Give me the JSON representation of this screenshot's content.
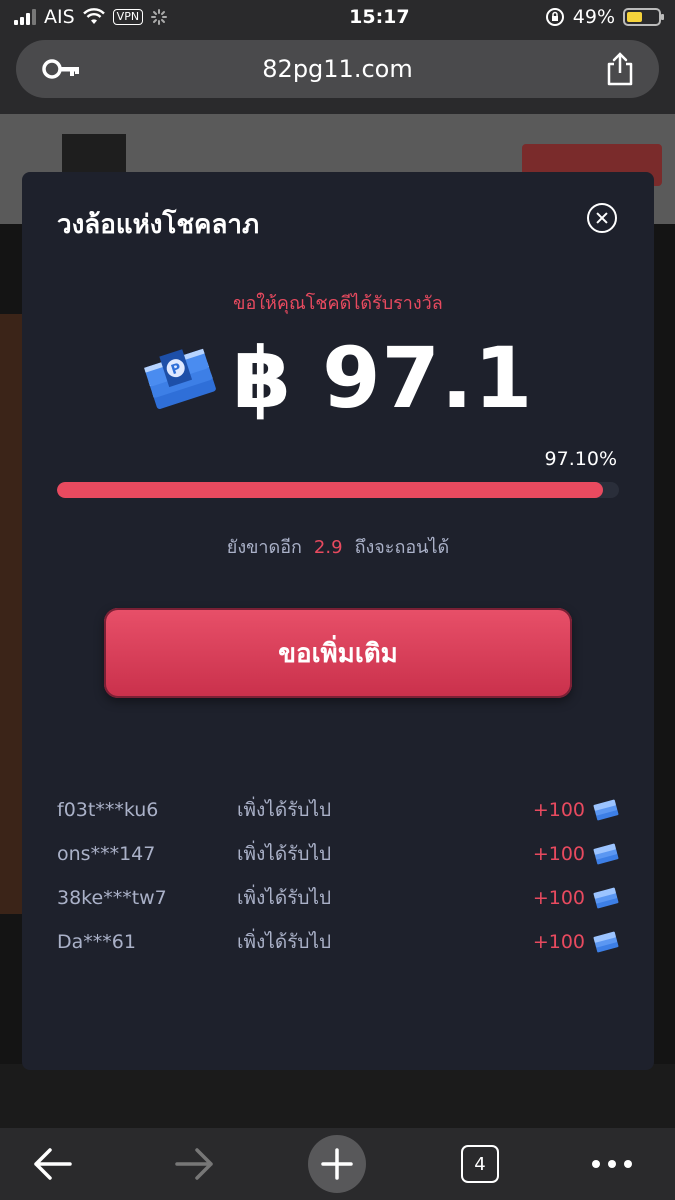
{
  "status_bar": {
    "carrier": "AIS",
    "vpn": "VPN",
    "time": "15:17",
    "battery_pct": "49%",
    "battery_fill": 0.49
  },
  "browser": {
    "url": "82pg11.com",
    "tab_count": "4"
  },
  "modal": {
    "title": "วงล้อแห่งโชคลาภ",
    "wish": "ขอให้คุณโชคดีได้รับรางวัล",
    "currency": "฿",
    "amount": "97.1",
    "progress_label": "97.10%",
    "progress": 0.971,
    "remaining_prefix": "ยังขาดอีก",
    "remaining_value": "2.9",
    "remaining_suffix": "ถึงจะถอนได้",
    "more_button": "ขอเพิ่มเติม",
    "winners": [
      {
        "user": "f03t***ku6",
        "text": "เพิ่งได้รับไป",
        "amount": "+100"
      },
      {
        "user": "ons***147",
        "text": "เพิ่งได้รับไป",
        "amount": "+100"
      },
      {
        "user": "38ke***tw7",
        "text": "เพิ่งได้รับไป",
        "amount": "+100"
      },
      {
        "user": "Da***61",
        "text": "เพิ่งได้รับไป",
        "amount": "+100"
      }
    ]
  },
  "icons": [
    "key-icon",
    "share-icon",
    "close-icon",
    "money-stack-icon",
    "back-arrow-icon",
    "forward-arrow-icon",
    "plus-icon",
    "more-dots-icon",
    "wifi-icon",
    "lock-rotation-icon"
  ],
  "colors": {
    "accent": "#e84a5f",
    "modal_bg": "#1e212c",
    "muted_text": "#aab1c8"
  }
}
